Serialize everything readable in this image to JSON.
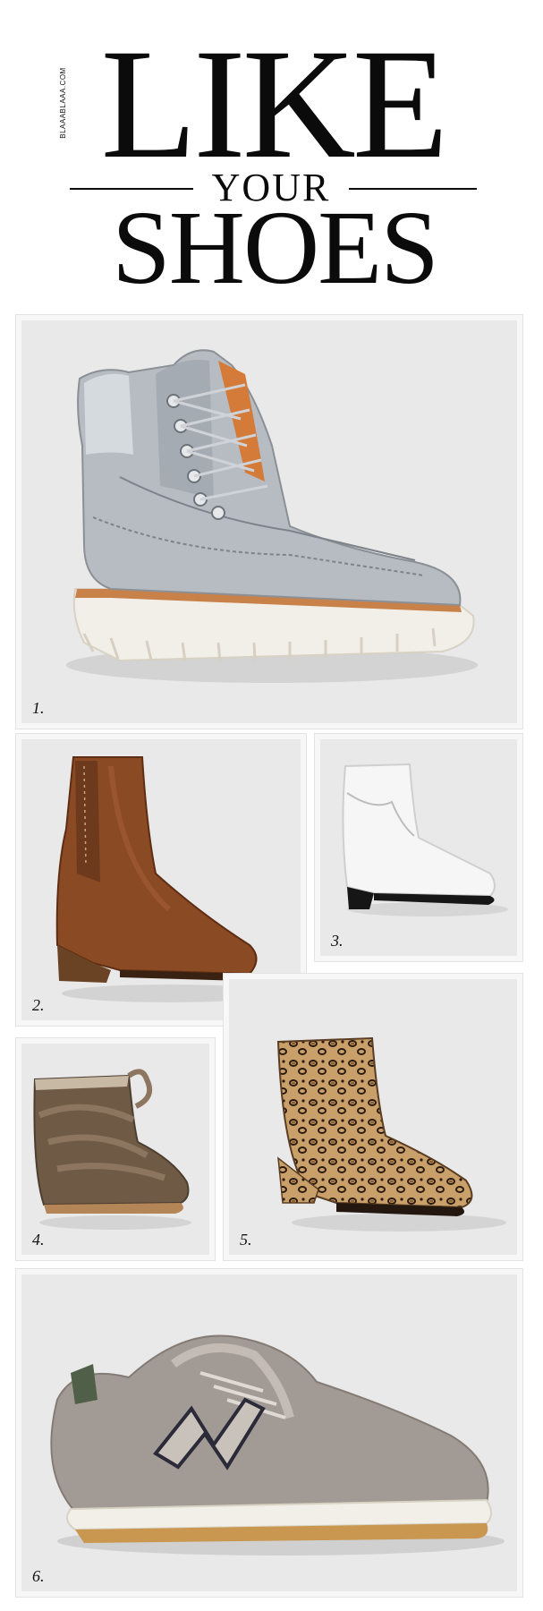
{
  "header": {
    "site_tag": "BLAAABLAAA.COM",
    "title_line1": "LIKE",
    "title_line2": "YOUR",
    "title_line3": "SHOES"
  },
  "items": [
    {
      "number": "1.",
      "name": "silver metallic lace-up boot"
    },
    {
      "number": "2.",
      "name": "brown leather ankle boot"
    },
    {
      "number": "3.",
      "name": "white patent ankle boot"
    },
    {
      "number": "4.",
      "name": "brown suede wrap bootie"
    },
    {
      "number": "5.",
      "name": "leopard print ankle boot"
    },
    {
      "number": "6.",
      "name": "grey suede sneaker"
    }
  ]
}
